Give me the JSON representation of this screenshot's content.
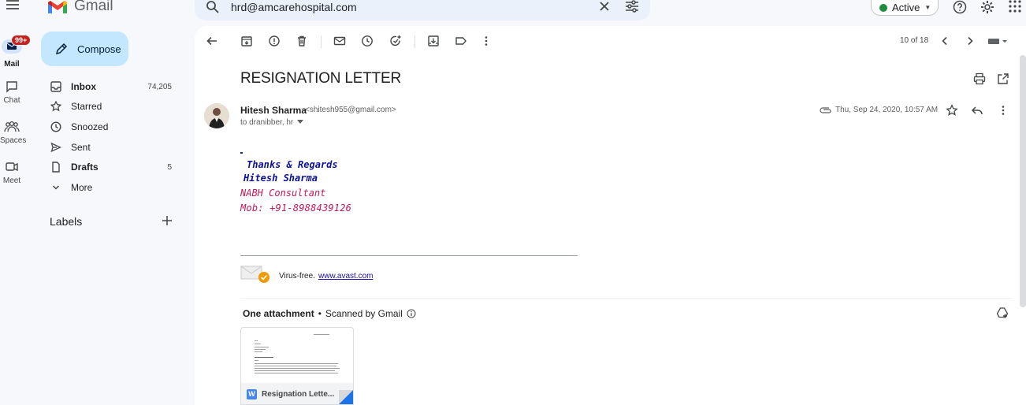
{
  "app": {
    "name": "Gmail"
  },
  "search": {
    "value": "hrd@amcarehospital.com"
  },
  "status": {
    "label": "Active",
    "color": "#1e8e3e"
  },
  "rail": {
    "mail": {
      "label": "Mail",
      "badge": "99+"
    },
    "chat": {
      "label": "Chat"
    },
    "spaces": {
      "label": "Spaces"
    },
    "meet": {
      "label": "Meet"
    }
  },
  "sidebar": {
    "compose_label": "Compose",
    "items": [
      {
        "label": "Inbox",
        "count": "74,205",
        "icon": "inbox-icon"
      },
      {
        "label": "Starred",
        "count": "",
        "icon": "star-icon"
      },
      {
        "label": "Snoozed",
        "count": "",
        "icon": "clock-icon"
      },
      {
        "label": "Sent",
        "count": "",
        "icon": "send-icon"
      },
      {
        "label": "Drafts",
        "count": "5",
        "icon": "draft-icon"
      },
      {
        "label": "More",
        "count": "",
        "icon": "chevron-down-icon"
      }
    ],
    "labels_heading": "Labels"
  },
  "toolbar": {
    "pager": "10 of 18"
  },
  "message": {
    "subject": "RESIGNATION LETTER",
    "sender_name": "Hitesh Sharma",
    "sender_email": "<shitesh955@gmail.com>",
    "recipients": "to dranibber, hr",
    "date": "Thu, Sep 24, 2020, 10:57 AM",
    "signature": {
      "line1": "Thanks & Regards",
      "line2": "Hitesh Sharma",
      "line3": "NABH Consultant",
      "line4": "Mob: +91-8988439126"
    },
    "virus_free_text": "Virus-free.",
    "virus_free_link": "www.avast.com"
  },
  "attachments": {
    "count_label": "One attachment",
    "separator": "•",
    "scanned_label": "Scanned by Gmail",
    "file_name": "Resignation Lette..."
  },
  "colors": {
    "accent": "#c2e7ff",
    "badge": "#c5221f",
    "brand_red": "#ea4335"
  }
}
